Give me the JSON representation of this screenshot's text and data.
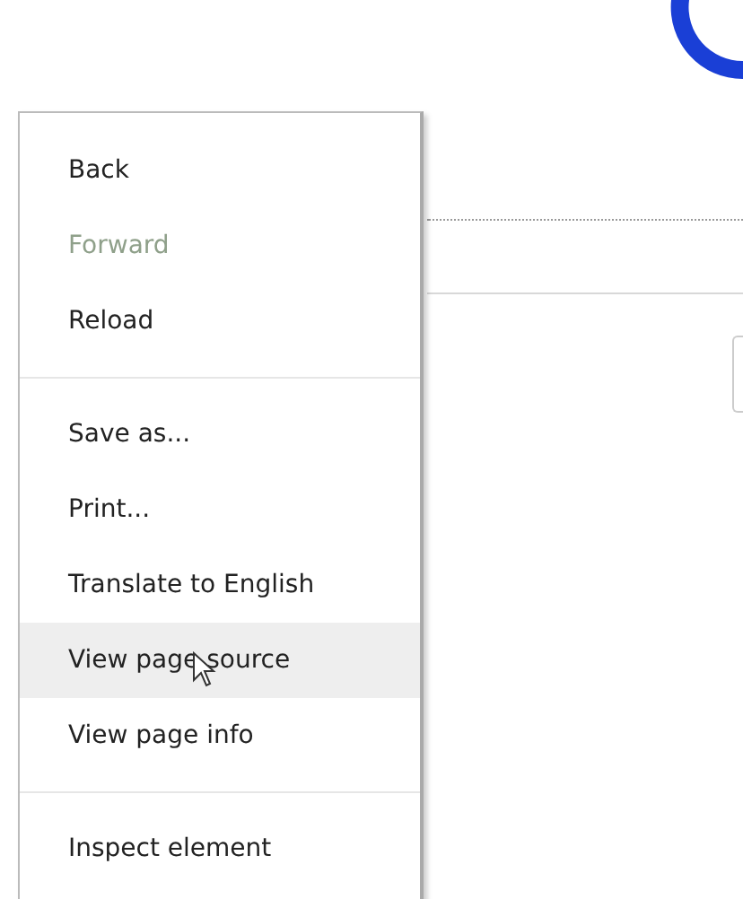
{
  "context_menu": {
    "items": [
      {
        "kind": "item",
        "label": "Back",
        "disabled": false,
        "selected": false
      },
      {
        "kind": "item",
        "label": "Forward",
        "disabled": true,
        "selected": false
      },
      {
        "kind": "item",
        "label": "Reload",
        "disabled": false,
        "selected": false
      },
      {
        "kind": "separator"
      },
      {
        "kind": "item",
        "label": "Save as...",
        "disabled": false,
        "selected": false
      },
      {
        "kind": "item",
        "label": "Print...",
        "disabled": false,
        "selected": false
      },
      {
        "kind": "item",
        "label": "Translate to English",
        "disabled": false,
        "selected": false
      },
      {
        "kind": "item",
        "label": "View page source",
        "disabled": false,
        "selected": true
      },
      {
        "kind": "item",
        "label": "View page info",
        "disabled": false,
        "selected": false
      },
      {
        "kind": "separator"
      },
      {
        "kind": "item",
        "label": "Inspect element",
        "disabled": false,
        "selected": false
      }
    ]
  }
}
